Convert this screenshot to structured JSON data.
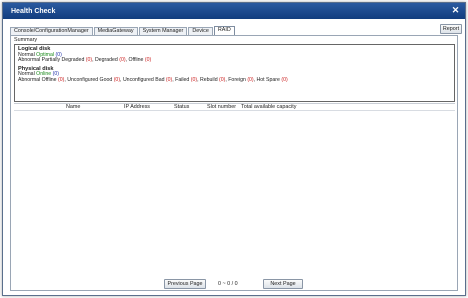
{
  "window": {
    "title": "Health Check"
  },
  "tabs": [
    {
      "label": "Console/ConfigurationManager"
    },
    {
      "label": "MediaGateway"
    },
    {
      "label": "System Manager"
    },
    {
      "label": "Device"
    },
    {
      "label": "RAID"
    }
  ],
  "report_label": "Report",
  "summary": {
    "label": "Summary",
    "logical": {
      "title": "Logical disk",
      "normal_label": "Normal",
      "normal_items": [
        {
          "name": "Optimal",
          "count": "(0)"
        }
      ],
      "abnormal_label": "Abnormal",
      "abnormal_items": [
        {
          "name": "Partially Degraded",
          "count": "(0)"
        },
        {
          "name": "Degraded",
          "count": "(0)"
        },
        {
          "name": "Offline",
          "count": "(0)"
        }
      ]
    },
    "physical": {
      "title": "Physical disk",
      "normal_label": "Normal",
      "normal_items": [
        {
          "name": "Online",
          "count": "(0)"
        }
      ],
      "abnormal_label": "Abnormal",
      "abnormal_items": [
        {
          "name": "Offline",
          "count": "(0)"
        },
        {
          "name": "Unconfigured Good",
          "count": "(0)"
        },
        {
          "name": "Unconfigured Bad",
          "count": "(0)"
        },
        {
          "name": "Failed",
          "count": "(0)"
        },
        {
          "name": "Rebuild",
          "count": "(0)"
        },
        {
          "name": "Foreign",
          "count": "(0)"
        },
        {
          "name": "Hot Spare",
          "count": "(0)"
        }
      ]
    }
  },
  "table": {
    "columns": [
      "Name",
      "IP Address",
      "Status",
      "Slot number",
      "Total available capacity"
    ]
  },
  "pager": {
    "prev_label": "Previous Page",
    "info": "0 ~ 0 / 0",
    "next_label": "Next Page"
  }
}
